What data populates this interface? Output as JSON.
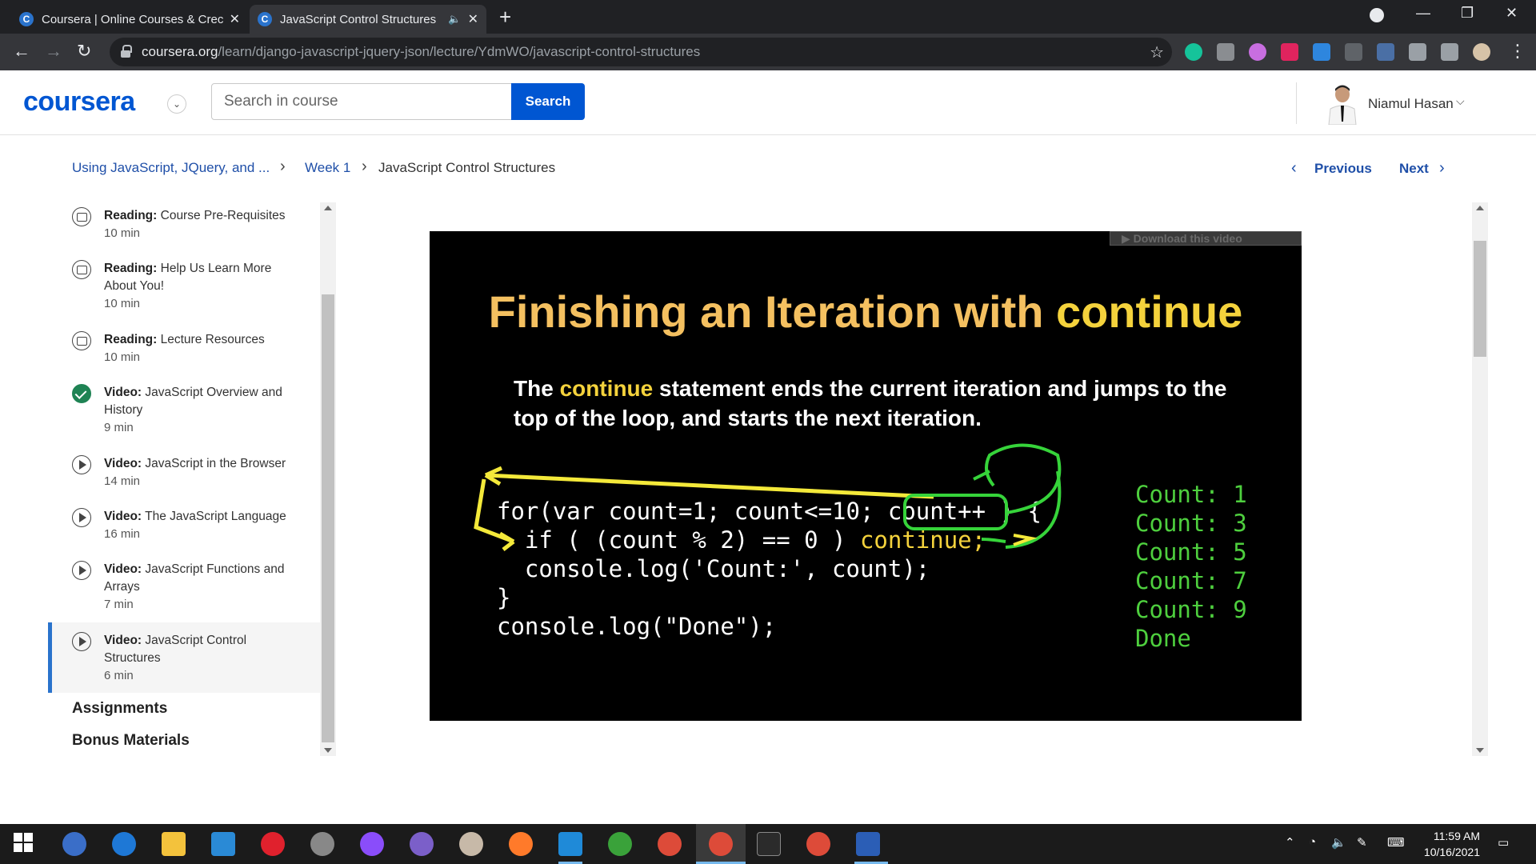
{
  "browser": {
    "tabs": [
      {
        "title": "Coursera | Online Courses & Crec",
        "favicon": "C"
      },
      {
        "title": "JavaScript Control Structures",
        "favicon": "C"
      }
    ],
    "url_host": "coursera.org",
    "url_path": "/learn/django-javascript-jquery-json/lecture/YdmWO/javascript-control-structures"
  },
  "header": {
    "logo": "coursera",
    "search_placeholder": "Search in course",
    "search_button": "Search",
    "user_name": "Niamul Hasan"
  },
  "breadcrumb": {
    "course": "Using JavaScript, JQuery, and ...",
    "week": "Week 1",
    "current": "JavaScript Control Structures"
  },
  "nav": {
    "previous": "Previous",
    "next": "Next"
  },
  "sidebar": {
    "items": [
      {
        "type": "Reading:",
        "title": "Course Pre-Requisites",
        "duration": "10 min",
        "icon": "book-icon"
      },
      {
        "type": "Reading:",
        "title": "Help Us Learn More About You!",
        "duration": "10 min",
        "icon": "book-icon"
      },
      {
        "type": "Reading:",
        "title": "Lecture Resources",
        "duration": "10 min",
        "icon": "book-icon"
      },
      {
        "type": "Video:",
        "title": "JavaScript Overview and History",
        "duration": "9 min",
        "icon": "check-circle-icon"
      },
      {
        "type": "Video:",
        "title": "JavaScript in the Browser",
        "duration": "14 min",
        "icon": "play-icon"
      },
      {
        "type": "Video:",
        "title": "The JavaScript Language",
        "duration": "16 min",
        "icon": "play-icon"
      },
      {
        "type": "Video:",
        "title": "JavaScript Functions and Arrays",
        "duration": "7 min",
        "icon": "play-icon"
      },
      {
        "type": "Video:",
        "title": "JavaScript Control Structures",
        "duration": "6 min",
        "icon": "play-icon"
      }
    ],
    "sections": [
      "Assignments",
      "Bonus Materials"
    ]
  },
  "video": {
    "download_label": "Download this video",
    "slide_title_pre": "Finishing an Iteration with ",
    "slide_title_kw": "continue",
    "body_pre": "The ",
    "body_kw": "continue",
    "body_post": " statement ends the current iteration and jumps to the top of the loop, and starts the next iteration.",
    "code_line1": "for(var count=1; count<=10; count++ ) {",
    "code_line2_pre": "  if ( (count % 2) == 0 ) ",
    "code_line2_kw": "continue;",
    "code_line3": "  console.log('Count:', count);",
    "code_line4": "}",
    "code_line5": "console.log(\"Done\");",
    "output": [
      "Count: 1",
      "Count: 3",
      "Count: 5",
      "Count: 7",
      "Count: 9",
      "Done"
    ]
  },
  "taskbar": {
    "time": "11:59 AM",
    "date": "10/16/2021"
  },
  "colors": {
    "brand": "#0056d2",
    "link": "#1f4fa8",
    "active_border": "#2a73cc",
    "done_green": "#1f8354"
  }
}
